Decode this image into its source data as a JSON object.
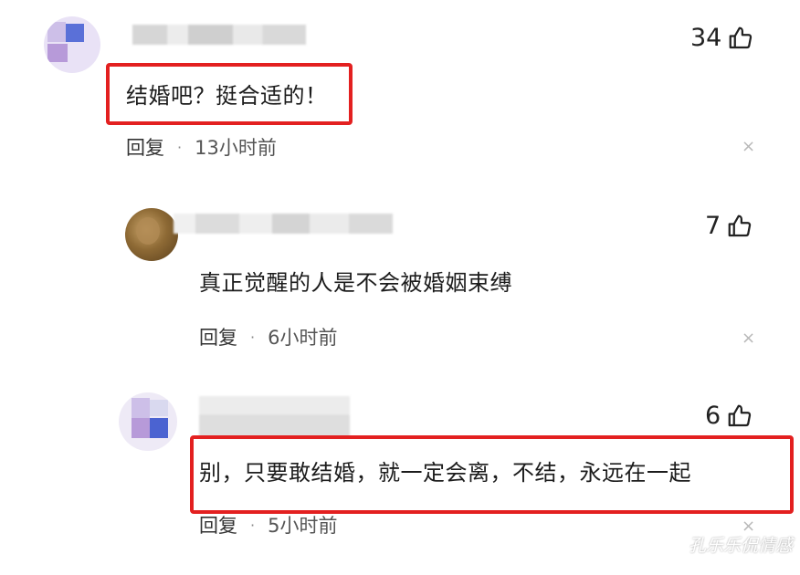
{
  "comments": [
    {
      "likes": "34",
      "text": "结婚吧？挺合适的！",
      "reply_label": "回复",
      "separator": "·",
      "time": "13小时前",
      "close_glyph": "×"
    },
    {
      "likes": "7",
      "text": "真正觉醒的人是不会被婚姻束缚",
      "reply_label": "回复",
      "separator": "·",
      "time": "6小时前",
      "close_glyph": "×"
    },
    {
      "likes": "6",
      "text": "别，只要敢结婚，就一定会离，不结，永远在一起",
      "reply_label": "回复",
      "separator": "·",
      "time": "5小时前",
      "close_glyph": "×"
    }
  ],
  "watermark": "孔乐乐侃情感",
  "colors": {
    "highlight": "#e32020",
    "avatar_purple": "#b79ad9",
    "avatar_blue": "#4b63d1",
    "avatar_lavender": "#cdbfe8",
    "avatar_photo": "#7a5a2c"
  },
  "icons": {
    "like": "thumbs-up-icon",
    "close": "close-icon"
  }
}
